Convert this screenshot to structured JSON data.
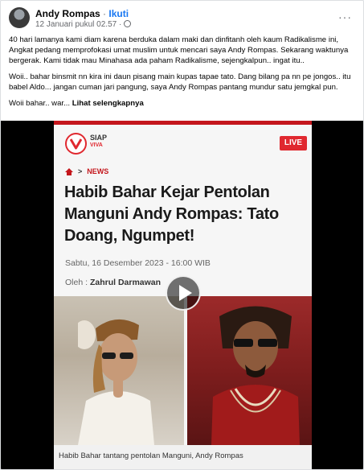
{
  "post": {
    "author": "Andy Rompas",
    "separator": "·",
    "follow_label": "Ikuti",
    "timestamp": "12 Januari pukul 02.57 ·",
    "paragraph1": "40 hari lamanya kami diam karena berduka dalam maki dan dinfitanh oleh kaum Radikalisme ini, Angkat pedang memprofokasi umat muslim untuk mencari saya Andy Rompas. Sekarang waktunya bergerak. Kami tidak mau Minahasa ada paham Radikalisme, sejengkalpun.. ingat itu..",
    "paragraph2": "Woii.. bahar binsmit nn kira ini daun pisang main kupas tapae tato. Dang bilang pa nn pe jongos.. itu babel Aldo... jangan cuman jari pangung, saya Andy Rompas pantang mundur satu jemgkal pun.",
    "paragraph3_text": "Woii bahar.. war... ",
    "see_more": "Lihat selengkapnya",
    "more_icon": "more-horizontal-icon"
  },
  "article": {
    "logo_main": "SIAP",
    "logo_sub": "VIVA",
    "live_label": "LIVE",
    "breadcrumb": "NEWS",
    "headline": "Habib Bahar Kejar Pentolan Manguni Andy Rompas: Tato Doang, Ngumpet!",
    "date": "Sabtu, 16 Desember 2023 - 16:00 WIB",
    "byline_prefix": "Oleh :",
    "byline_author": "Zahrul Darmawan",
    "caption": "Habib Bahar tantang pentolan Manguni, Andy Rompas",
    "accent_color": "#e0282f"
  }
}
